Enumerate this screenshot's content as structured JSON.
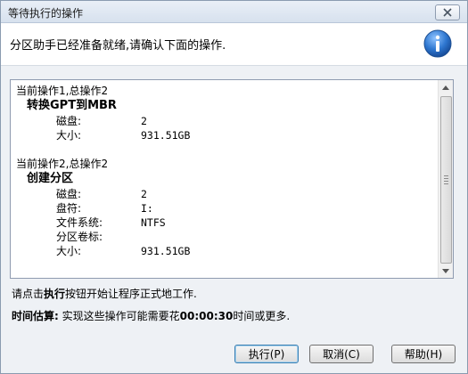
{
  "window": {
    "title": "等待执行的操作"
  },
  "header": {
    "text": "分区助手已经准备就绪,请确认下面的操作."
  },
  "operations": [
    {
      "heading": "当前操作1,总操作2",
      "name": "转换GPT到MBR",
      "props": [
        {
          "k": "磁盘:",
          "v": "2"
        },
        {
          "k": "大小:",
          "v": "931.51GB"
        }
      ]
    },
    {
      "heading": "当前操作2,总操作2",
      "name": "创建分区",
      "props": [
        {
          "k": "磁盘:",
          "v": "2"
        },
        {
          "k": "盘符:",
          "v": "I:"
        },
        {
          "k": "文件系统:",
          "v": "NTFS"
        },
        {
          "k": "分区卷标:",
          "v": ""
        },
        {
          "k": "大小:",
          "v": "931.51GB"
        }
      ]
    }
  ],
  "notes": {
    "line1_prefix": "请点击",
    "line1_bold": "执行",
    "line1_suffix": "按钮开始让程序正式地工作.",
    "line2_bold_label": "时间估算:",
    "line2_mid": " 实现这些操作可能需要花",
    "line2_bold_time": "00:00:30",
    "line2_suffix": "时间或更多."
  },
  "buttons": {
    "execute": "执行(P)",
    "cancel": "取消(C)",
    "help": "帮助(H)"
  }
}
